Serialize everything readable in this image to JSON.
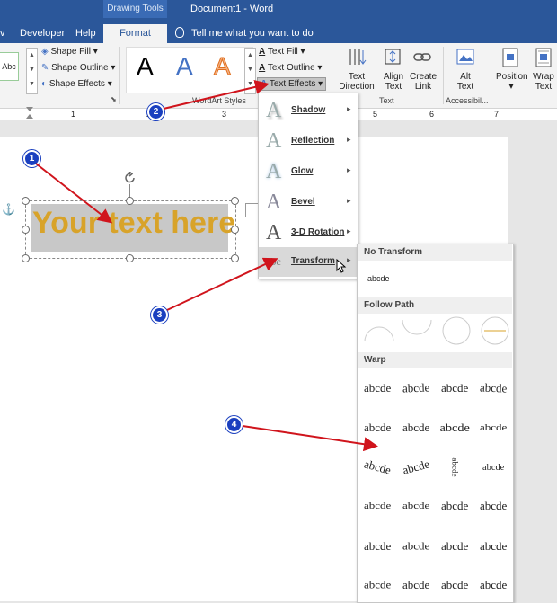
{
  "window": {
    "title": "Document1  -  Word",
    "context_tab": "Drawing Tools"
  },
  "tabs": {
    "view_partial": "v",
    "developer": "Developer",
    "help": "Help",
    "format": "Format",
    "tell_me": "Tell me what you want to do"
  },
  "ribbon": {
    "style_abc": "Abc",
    "shape_fill": "Shape Fill",
    "shape_outline": "Shape Outline",
    "shape_effects": "Shape Effects",
    "wordart_letter": "A",
    "wordart_styles_label": "WordArt Styles",
    "text_fill": "Text Fill",
    "text_outline": "Text Outline",
    "text_effects": "Text Effects",
    "text_direction": "Text Direction",
    "align_text": "Align Text",
    "create_link": "Create Link",
    "text_group_label": "Text",
    "alt_text": "Alt Text",
    "accessibility_label": "Accessibil...",
    "position": "Position",
    "wrap_text": "Wrap Text",
    "wordart_colors": [
      "#000000",
      "#4472c4",
      "#f4b183"
    ]
  },
  "ruler": {
    "marks": [
      "1",
      "2",
      "3",
      "4",
      "5",
      "6",
      "7"
    ]
  },
  "document": {
    "textbox_text": "Your text here",
    "textbox_fill": "#c8c8c8",
    "textbox_text_color": "#d8a32a"
  },
  "text_effects_menu": {
    "items": [
      {
        "label": "Shadow",
        "icon": "shadow-A-icon"
      },
      {
        "label": "Reflection",
        "icon": "reflection-A-icon"
      },
      {
        "label": "Glow",
        "icon": "glow-A-icon"
      },
      {
        "label": "Bevel",
        "icon": "bevel-A-icon"
      },
      {
        "label": "3-D Rotation",
        "icon": "rotation-A-icon"
      },
      {
        "label": "Transform",
        "icon": "transform-abc-icon"
      }
    ]
  },
  "transform_menu": {
    "no_transform_header": "No Transform",
    "no_transform_sample": "abcde",
    "follow_path_header": "Follow Path",
    "warp_header": "Warp",
    "warp_sample": "abcde"
  },
  "callouts": [
    "1",
    "2",
    "3",
    "4"
  ],
  "colors": {
    "title_bar": "#2b579a",
    "callout": "#1a3fbf",
    "arrow": "#d0141c"
  }
}
